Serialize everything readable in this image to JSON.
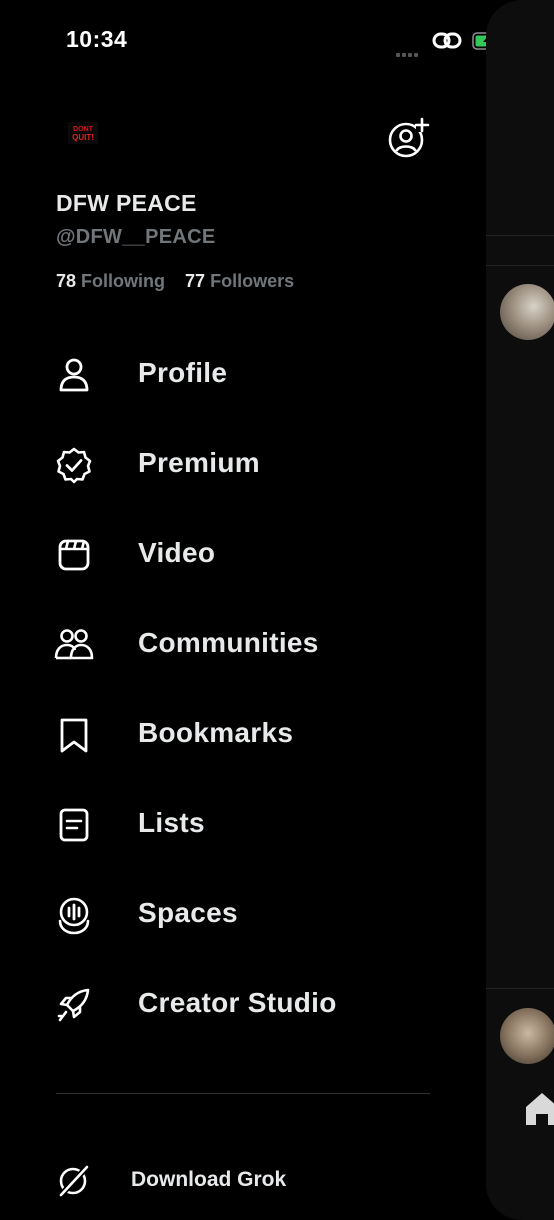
{
  "status_bar": {
    "time": "10:34"
  },
  "profile": {
    "avatar_text": "DONT QUIT!",
    "display_name": "DFW PEACE",
    "handle": "@DFW__PEACE",
    "following_count": "78",
    "following_label": "Following",
    "followers_count": "77",
    "followers_label": "Followers"
  },
  "menu": [
    {
      "label": "Profile",
      "icon": "person-icon"
    },
    {
      "label": "Premium",
      "icon": "verified-badge-icon"
    },
    {
      "label": "Video",
      "icon": "video-icon"
    },
    {
      "label": "Communities",
      "icon": "communities-icon"
    },
    {
      "label": "Bookmarks",
      "icon": "bookmark-icon"
    },
    {
      "label": "Lists",
      "icon": "list-icon"
    },
    {
      "label": "Spaces",
      "icon": "spaces-icon"
    },
    {
      "label": "Creator Studio",
      "icon": "rocket-icon"
    }
  ],
  "footer": {
    "grok_label": "Download Grok"
  },
  "colors": {
    "background": "#000000",
    "text_primary": "#e7e9ea",
    "text_secondary": "#71767b",
    "battery_green": "#34c759"
  }
}
